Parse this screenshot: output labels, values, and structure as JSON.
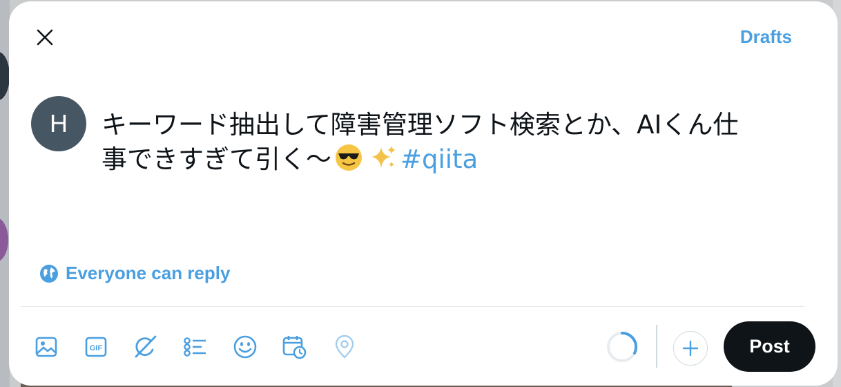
{
  "header": {
    "drafts_label": "Drafts"
  },
  "user": {
    "avatar_initial": "H"
  },
  "composer": {
    "text_line1": "キーワード抽出して障害管理ソフト検索とか、AIくん仕",
    "text_line2": "事できすぎて引く〜",
    "emojis": [
      "sunglasses-face-emoji",
      "sparkles-emoji"
    ],
    "hashtag": "#qiita"
  },
  "reply_setting": {
    "label": "Everyone can reply"
  },
  "toolbar": {
    "tools": [
      "image-icon",
      "gif-icon",
      "grok-icon",
      "poll-icon",
      "emoji-icon",
      "schedule-icon",
      "location-icon"
    ]
  },
  "actions": {
    "post_label": "Post"
  },
  "colors": {
    "accent": "#4a9fe0",
    "post_button": "#0f1419",
    "avatar_bg": "#465663"
  }
}
